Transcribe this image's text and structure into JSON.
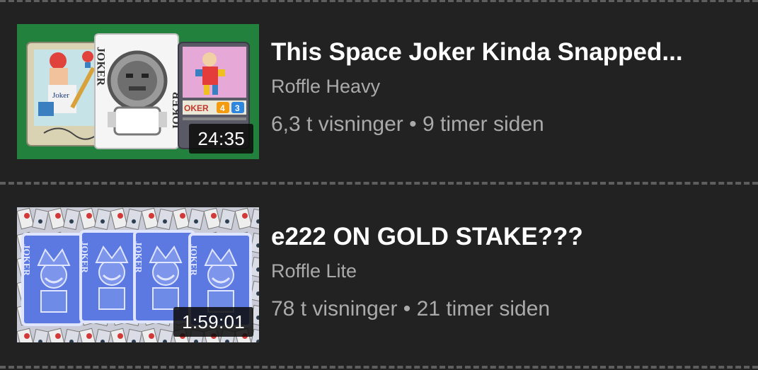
{
  "videos": [
    {
      "title": "This Space Joker Kinda Snapped...",
      "channel": "Roffle Heavy",
      "views": "6,3 t visninger",
      "separator": "•",
      "age": "9 timer siden",
      "duration": "24:35",
      "thumbnail": {
        "background": "#1e7a3a",
        "icons": [
          "baseball-card-icon",
          "space-joker-card-icon",
          "joker-card-icon"
        ],
        "card_texts": [
          "Joker",
          "JOKER",
          "OKER",
          "4",
          "3"
        ]
      }
    },
    {
      "title": "e222 ON GOLD STAKE???",
      "channel": "Roffle Lite",
      "views": "78 t visninger",
      "separator": "•",
      "age": "21 timer siden",
      "duration": "1:59:01",
      "thumbnail": {
        "background": "#c9ccd6",
        "icons": [
          "joker-card-icon",
          "joker-card-icon",
          "joker-card-icon",
          "joker-card-icon"
        ],
        "card_texts": [
          "JOKER",
          "JOKER",
          "JOKER",
          "JOKER"
        ]
      }
    }
  ],
  "colors": {
    "background": "#222222",
    "title": "#ffffff",
    "secondary_text": "#aaaaaa",
    "divider": "#5e5e5e"
  }
}
